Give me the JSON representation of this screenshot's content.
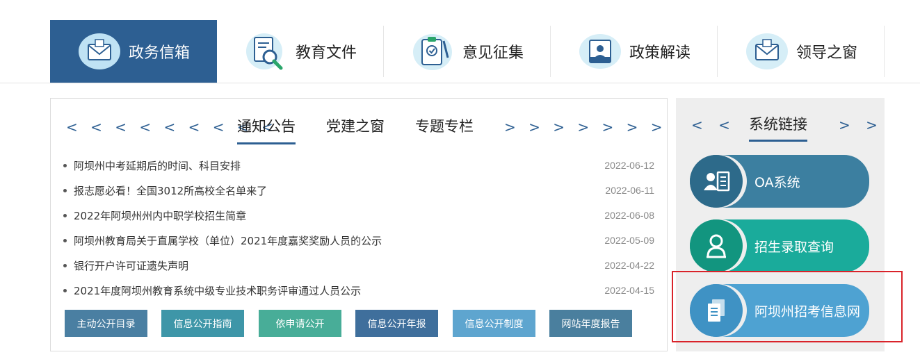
{
  "top_nav": {
    "tabs": [
      {
        "label": "政务信箱",
        "icon": "envelope-icon",
        "active": true
      },
      {
        "label": "教育文件",
        "icon": "document-search-icon",
        "active": false
      },
      {
        "label": "意见征集",
        "icon": "clipboard-check-icon",
        "active": false
      },
      {
        "label": "政策解读",
        "icon": "id-card-icon",
        "active": false
      },
      {
        "label": "领导之窗",
        "icon": "envelope-icon",
        "active": false
      }
    ]
  },
  "news_panel": {
    "left_arrows": "< < < < < < < < <",
    "right_arrows": "> > > > > > > > >",
    "tabs": [
      {
        "label": "通知公告",
        "active": true
      },
      {
        "label": "党建之窗",
        "active": false
      },
      {
        "label": "专题专栏",
        "active": false
      }
    ],
    "items": [
      {
        "title": "阿坝州中考延期后的时间、科目安排",
        "date": "2022-06-12"
      },
      {
        "title": "报志愿必看！全国3012所高校全名单来了",
        "date": "2022-06-11"
      },
      {
        "title": "2022年阿坝州州内中职学校招生简章",
        "date": "2022-06-08"
      },
      {
        "title": "阿坝州教育局关于直属学校（单位）2021年度嘉奖奖励人员的公示",
        "date": "2022-05-09"
      },
      {
        "title": "银行开户许可证遗失声明",
        "date": "2022-04-22"
      },
      {
        "title": "2021年度阿坝州教育系统中级专业技术职务评审通过人员公示",
        "date": "2022-04-15"
      }
    ],
    "buttons": [
      {
        "label": "主动公开目录",
        "color": "#4a7fa2"
      },
      {
        "label": "信息公开指南",
        "color": "#3e96a8"
      },
      {
        "label": "依申请公开",
        "color": "#48ad98"
      },
      {
        "label": "信息公开年报",
        "color": "#3f6f9c"
      },
      {
        "label": "信息公开制度",
        "color": "#5ea5cf"
      },
      {
        "label": "网站年度报告",
        "color": "#4a7f9e"
      }
    ]
  },
  "links_panel": {
    "title": "系统链接",
    "left_arrows": "< <",
    "right_arrows": "> >",
    "cards": [
      {
        "label": "OA系统",
        "icon": "user-card-icon",
        "color": "#3c7fa0",
        "circle_color": "#2d6a8a"
      },
      {
        "label": "招生录取查询",
        "icon": "person-icon",
        "color": "#1aab9b",
        "circle_color": "#12957f"
      },
      {
        "label": "阿坝州招考信息网",
        "icon": "documents-icon",
        "color": "#4ea2d2",
        "circle_color": "#3f92c4"
      }
    ]
  },
  "colors": {
    "accent": "#2d5f92",
    "highlight_border": "#d9232a"
  }
}
